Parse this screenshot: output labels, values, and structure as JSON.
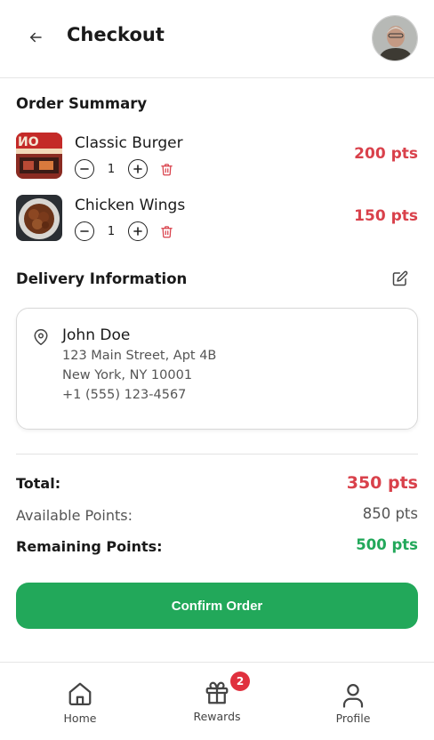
{
  "header": {
    "title": "Checkout"
  },
  "order_summary": {
    "title": "Order Summary",
    "items": [
      {
        "name": "Classic Burger",
        "quantity": "1",
        "points": "200 pts",
        "image": "burger-photo"
      },
      {
        "name": "Chicken Wings",
        "quantity": "1",
        "points": "150 pts",
        "image": "wings-photo"
      }
    ]
  },
  "delivery": {
    "title": "Delivery Information",
    "name": "John Doe",
    "street": "123 Main Street, Apt 4B",
    "city": "New York, NY 10001",
    "phone": "+1 (555) 123-4567"
  },
  "summary": {
    "total_label": "Total:",
    "total_value": "350 pts",
    "available_label": "Available Points:",
    "available_value": "850 pts",
    "remaining_label": "Remaining Points:",
    "remaining_value": "500 pts"
  },
  "confirm_label": "Confirm Order",
  "nav": {
    "items": [
      {
        "label": "Home",
        "icon": "home-icon"
      },
      {
        "label": "Rewards",
        "icon": "gift-icon",
        "badge": "2"
      },
      {
        "label": "Profile",
        "icon": "user-icon"
      }
    ]
  },
  "colors": {
    "accent_green": "#22a85a",
    "points_red": "#d9414b",
    "badge_red": "#e0303e"
  }
}
